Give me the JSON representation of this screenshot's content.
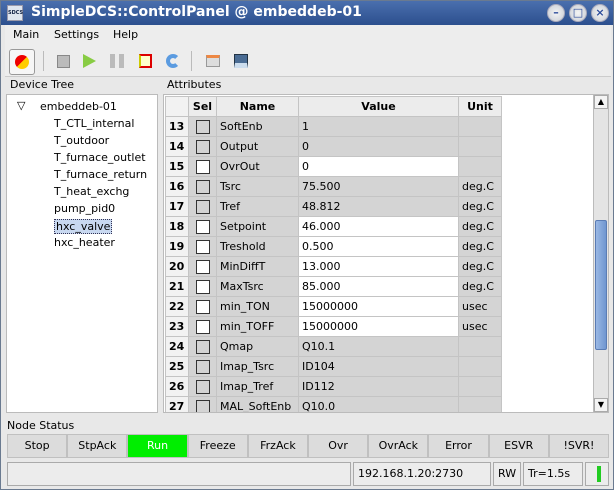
{
  "window": {
    "title": "SimpleDCS::ControlPanel @ embeddeb-01",
    "icon_text": "SDCS"
  },
  "menu": [
    "Main",
    "Settings",
    "Help"
  ],
  "toolbar": [
    "connect-icon",
    "stop-icon",
    "play-icon",
    "pause-icon",
    "signal-icon",
    "refresh-icon",
    "export-icon",
    "save-icon"
  ],
  "device_tree": {
    "title": "Device Tree",
    "root": "embeddeb-01",
    "items": [
      "T_CTL_internal",
      "T_outdoor",
      "T_furnace_outlet",
      "T_furnace_return",
      "T_heat_exchg",
      "pump_pid0",
      "hxc_valve",
      "hxc_heater"
    ],
    "selected": "hxc_valve"
  },
  "attributes": {
    "title": "Attributes",
    "columns": [
      "Sel",
      "Name",
      "Value",
      "Unit"
    ],
    "rows": [
      {
        "n": "13",
        "name": "SoftEnb",
        "value": "1",
        "unit": "",
        "editable": false
      },
      {
        "n": "14",
        "name": "Output",
        "value": "0",
        "unit": "",
        "editable": false
      },
      {
        "n": "15",
        "name": "OvrOut",
        "value": "0",
        "unit": "",
        "editable": true
      },
      {
        "n": "16",
        "name": "Tsrc",
        "value": "75.500",
        "unit": "deg.C",
        "editable": false
      },
      {
        "n": "17",
        "name": "Tref",
        "value": "48.812",
        "unit": "deg.C",
        "editable": false
      },
      {
        "n": "18",
        "name": "Setpoint",
        "value": "46.000",
        "unit": "deg.C",
        "editable": true
      },
      {
        "n": "19",
        "name": "Treshold",
        "value": "0.500",
        "unit": "deg.C",
        "editable": true
      },
      {
        "n": "20",
        "name": "MinDiffT",
        "value": "13.000",
        "unit": "deg.C",
        "editable": true
      },
      {
        "n": "21",
        "name": "MaxTsrc",
        "value": "85.000",
        "unit": "deg.C",
        "editable": true
      },
      {
        "n": "22",
        "name": "min_TON",
        "value": "15000000",
        "unit": "usec",
        "editable": true
      },
      {
        "n": "23",
        "name": "min_TOFF",
        "value": "15000000",
        "unit": "usec",
        "editable": true
      },
      {
        "n": "24",
        "name": "Qmap",
        "value": "Q10.1",
        "unit": "",
        "editable": false
      },
      {
        "n": "25",
        "name": "Imap_Tsrc",
        "value": "ID104",
        "unit": "",
        "editable": false
      },
      {
        "n": "26",
        "name": "Imap_Tref",
        "value": "ID112",
        "unit": "",
        "editable": false
      },
      {
        "n": "27",
        "name": "MAL_SoftEnb",
        "value": "Q10.0",
        "unit": "",
        "editable": false
      }
    ]
  },
  "node_status": {
    "title": "Node Status",
    "states": [
      "Stop",
      "StpAck",
      "Run",
      "Freeze",
      "FrzAck",
      "Ovr",
      "OvrAck",
      "Error",
      "ESVR",
      "!SVR!"
    ],
    "active": "Run",
    "active_color": "#00ee00"
  },
  "statusbar": {
    "address": "192.168.1.20:2730",
    "mode": "RW",
    "tr": "Tr=1.5s",
    "indicator_color": "#22cc22"
  }
}
